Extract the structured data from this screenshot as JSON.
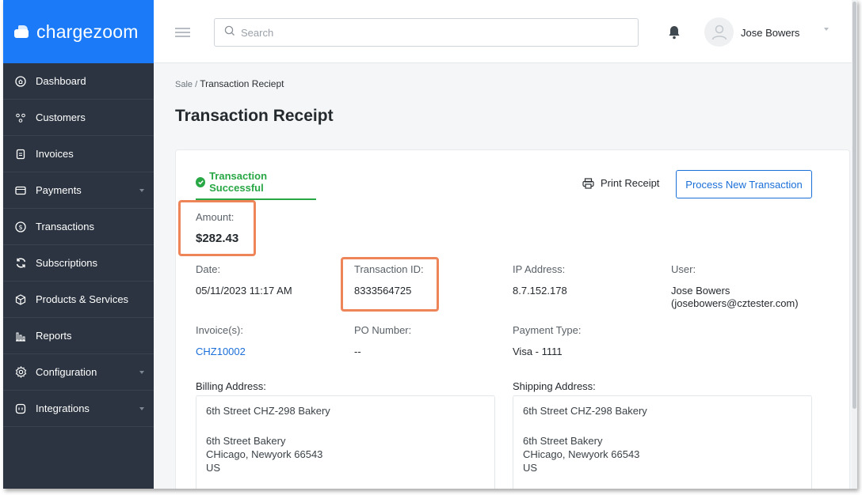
{
  "brand": {
    "name": "chargezoom"
  },
  "sidebar": {
    "items": [
      {
        "label": "Dashboard",
        "icon": "home-icon",
        "has_submenu": false
      },
      {
        "label": "Customers",
        "icon": "users-icon",
        "has_submenu": false
      },
      {
        "label": "Invoices",
        "icon": "invoice-icon",
        "has_submenu": false
      },
      {
        "label": "Payments",
        "icon": "card-icon",
        "has_submenu": true
      },
      {
        "label": "Transactions",
        "icon": "dollar-icon",
        "has_submenu": false
      },
      {
        "label": "Subscriptions",
        "icon": "refresh-icon",
        "has_submenu": false
      },
      {
        "label": "Products & Services",
        "icon": "box-icon",
        "has_submenu": false
      },
      {
        "label": "Reports",
        "icon": "bar-chart-icon",
        "has_submenu": false
      },
      {
        "label": "Configuration",
        "icon": "gear-icon",
        "has_submenu": true
      },
      {
        "label": "Integrations",
        "icon": "plug-icon",
        "has_submenu": true
      }
    ]
  },
  "header": {
    "search_placeholder": "Search",
    "user_name": "Jose Bowers"
  },
  "breadcrumb": {
    "parent": "Sale",
    "separator": " / ",
    "current": "Transaction Reciept"
  },
  "page_title": "Transaction Receipt",
  "receipt": {
    "status": "Transaction Successful",
    "print_label": "Print Receipt",
    "new_transaction_label": "Process New Transaction",
    "amount_label": "Amount:",
    "amount": "$282.43",
    "date_label": "Date:",
    "date": "05/11/2023 11:17 AM",
    "transaction_id_label": "Transaction ID:",
    "transaction_id": "8333564725",
    "ip_label": "IP Address:",
    "ip": "8.7.152.178",
    "user_label": "User:",
    "user_name": "Jose Bowers",
    "user_email": "(josebowers@cztester.com)",
    "invoices_label": "Invoice(s):",
    "invoice": "CHZ10002",
    "po_label": "PO Number:",
    "po": "--",
    "payment_type_label": "Payment Type:",
    "payment_type": "Visa - 1111",
    "billing_label": "Billing Address:",
    "billing": {
      "line1": "6th Street CHZ-298 Bakery",
      "line2": "6th Street Bakery",
      "line3": "CHicago, Newyork 66543",
      "line4": "US"
    },
    "shipping_label": "Shipping Address:",
    "shipping": {
      "line1": "6th Street CHZ-298 Bakery",
      "line2": "6th Street Bakery",
      "line3": "CHicago, Newyork 66543",
      "line4": "US"
    }
  },
  "colors": {
    "brand_blue": "#1a7af8",
    "sidebar_bg": "#2b3440",
    "success_green": "#28a745",
    "link_blue": "#1a6fd8",
    "highlight_orange": "#ee8558"
  }
}
